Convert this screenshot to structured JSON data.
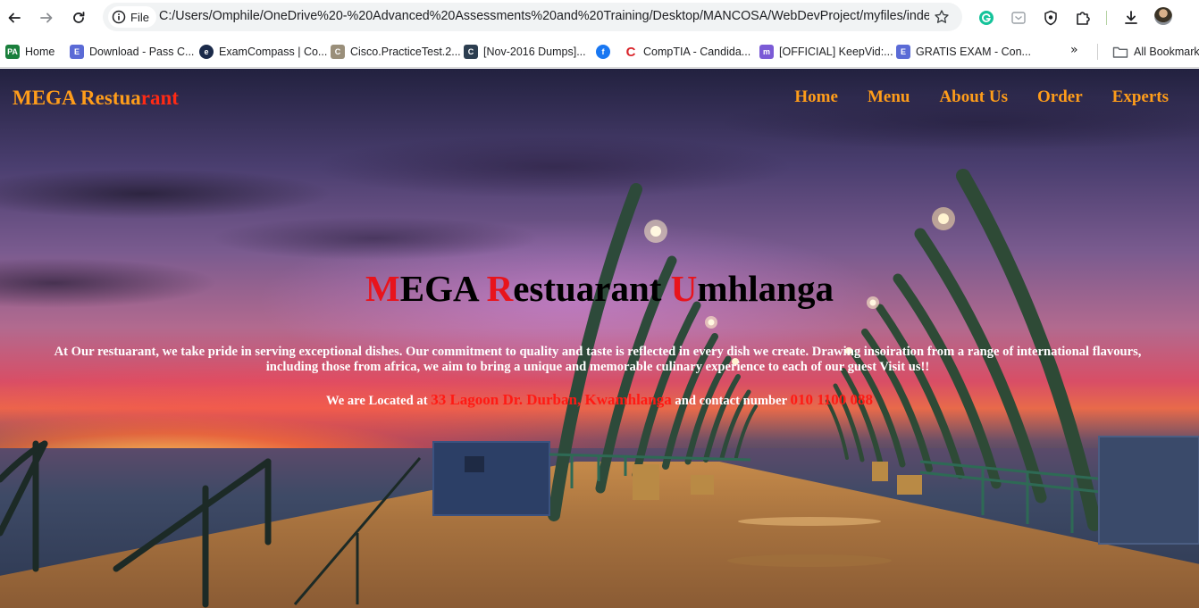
{
  "browser": {
    "site_info_label": "File",
    "url": "C:/Users/Omphile/OneDrive%20-%20Advanced%20Assessments%20and%20Training/Desktop/MANCOSA/WebDevProject/myfiles/index.h...",
    "bookmarks": [
      {
        "label": "Home",
        "icon": "pa-favicon",
        "color": "#1a7f3c"
      },
      {
        "label": "Download - Pass C...",
        "icon": "doc-favicon",
        "color": "#5b6bd6"
      },
      {
        "label": "ExamCompass | Co...",
        "icon": "examcompass-favicon",
        "color": "#1b2a4a"
      },
      {
        "label": "Cisco.PracticeTest.2...",
        "icon": "cisco-favicon",
        "color": "#9a8f7a"
      },
      {
        "label": "[Nov-2016 Dumps]...",
        "icon": "dumps-favicon",
        "color": "#2c3e50"
      },
      {
        "label": "",
        "icon": "facebook-favicon",
        "color": "#1877f2"
      },
      {
        "label": "CompTIA - Candida...",
        "icon": "comptia-favicon",
        "color": "#d9242a"
      },
      {
        "label": "[OFFICIAL] KeepVid:...",
        "icon": "keepvid-favicon",
        "color": "#7b5bd6"
      },
      {
        "label": "GRATIS EXAM - Con...",
        "icon": "gratis-favicon",
        "color": "#5b6bd6"
      }
    ],
    "more_bookmarks_glyph": "»",
    "all_bookmarks_label": "All Bookmarks"
  },
  "site": {
    "brand_part1": "MEGA Restua",
    "brand_part2": "rant",
    "nav": [
      "Home",
      "Menu",
      "About Us",
      "Order",
      "Experts"
    ],
    "hero_title": {
      "c1": "M",
      "t1": "EGA ",
      "c2": "R",
      "t2": "estuarant ",
      "c3": "U",
      "t3": "mhlanga"
    },
    "hero_paragraph": "At Our restuarant, we take pride in serving exceptional dishes. Our commitment to quality and taste is reflected in every dish we create. Drawing insoiration from a range of international flavours, including those from africa, we aim to bring a unique and memorable culinary experience to each of our guest Visit us!!",
    "location_prefix": "We are Located at ",
    "address": "33 Lagoon Dr. Durban, Kwamhlanga",
    "location_mid": " and contact number ",
    "phone": "010 1100 088"
  },
  "colors": {
    "brand_orange": "#ff9d1a",
    "accent_red": "#e8141c"
  }
}
